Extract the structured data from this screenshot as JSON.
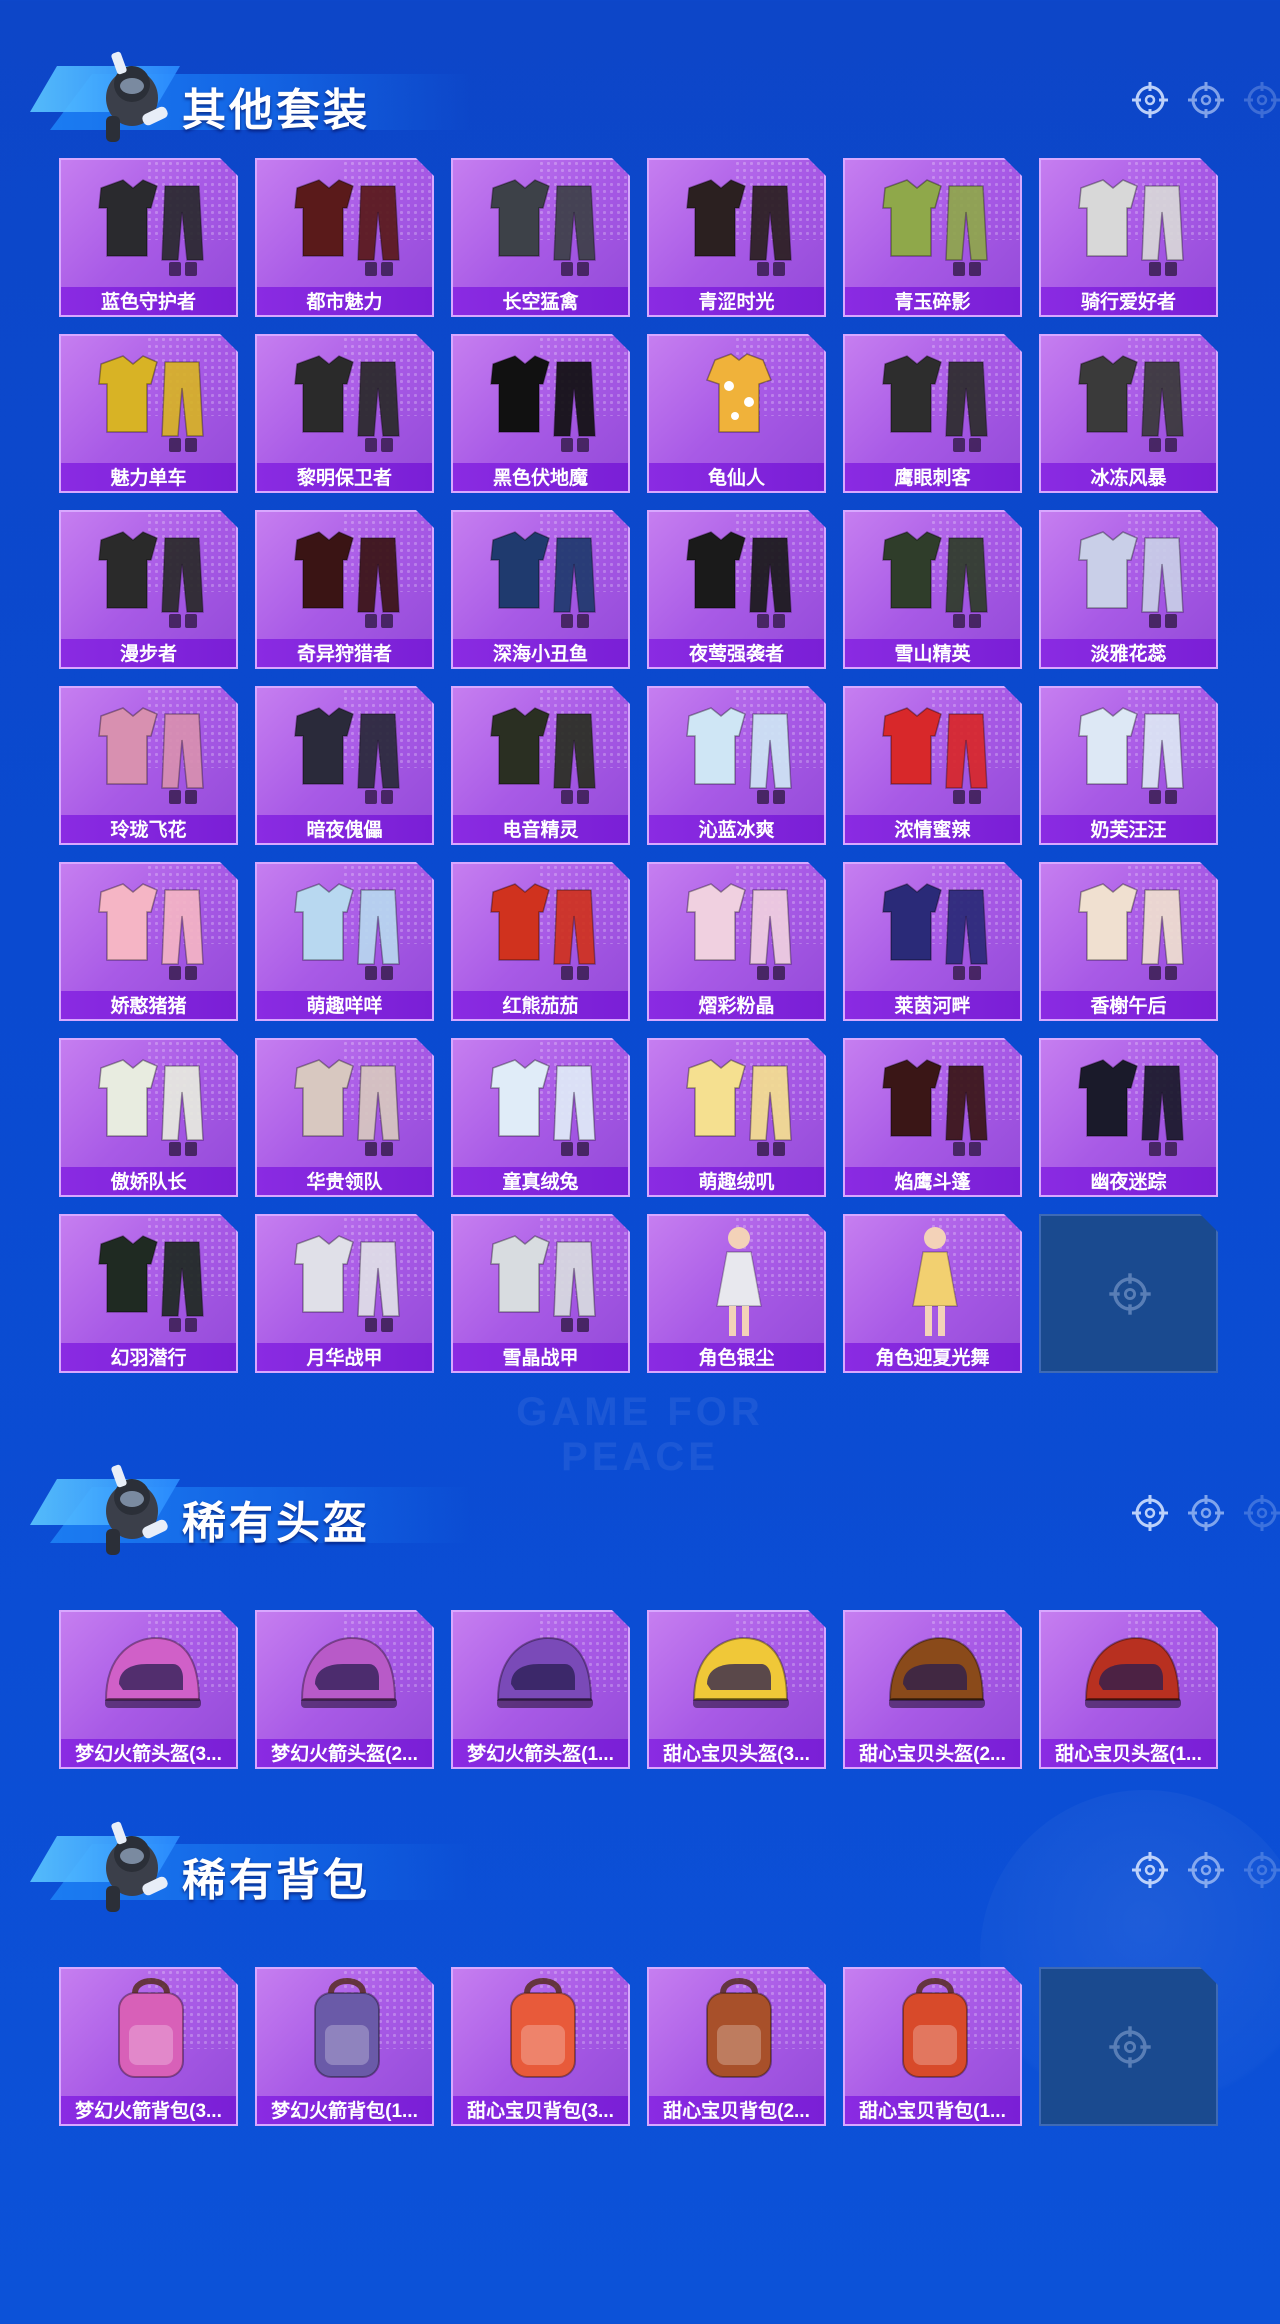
{
  "sections": [
    {
      "title": "其他套装",
      "items": [
        {
          "label": "蓝色守护者",
          "kind": "outfit",
          "color": "#2a2a2e"
        },
        {
          "label": "都市魅力",
          "kind": "outfit",
          "color": "#5a1a1a"
        },
        {
          "label": "长空猛禽",
          "kind": "outfit",
          "color": "#3d4148"
        },
        {
          "label": "青涩时光",
          "kind": "outfit",
          "color": "#2b2020"
        },
        {
          "label": "青玉碎影",
          "kind": "outfit",
          "color": "#8fa84a"
        },
        {
          "label": "骑行爱好者",
          "kind": "outfit",
          "color": "#d8d8d8"
        },
        {
          "label": "魅力单车",
          "kind": "outfit",
          "color": "#d8b325"
        },
        {
          "label": "黎明保卫者",
          "kind": "outfit",
          "color": "#2a2a2a"
        },
        {
          "label": "黑色伏地魔",
          "kind": "outfit",
          "color": "#111111"
        },
        {
          "label": "龟仙人",
          "kind": "shirt",
          "color": "#f0b23a"
        },
        {
          "label": "鹰眼刺客",
          "kind": "outfit",
          "color": "#2d2d2d"
        },
        {
          "label": "冰冻风暴",
          "kind": "outfit",
          "color": "#3a3a3a"
        },
        {
          "label": "漫步者",
          "kind": "outfit",
          "color": "#2a2a2a"
        },
        {
          "label": "奇异狩猎者",
          "kind": "outfit",
          "color": "#3a1414"
        },
        {
          "label": "深海小丑鱼",
          "kind": "outfit",
          "color": "#1f3a6e"
        },
        {
          "label": "夜莺强袭者",
          "kind": "outfit",
          "color": "#1a1a1a"
        },
        {
          "label": "雪山精英",
          "kind": "outfit",
          "color": "#2f3d2a"
        },
        {
          "label": "淡雅花蕊",
          "kind": "outfit",
          "color": "#c9cfe8"
        },
        {
          "label": "玲珑飞花",
          "kind": "outfit",
          "color": "#d890b0"
        },
        {
          "label": "暗夜傀儡",
          "kind": "outfit",
          "color": "#2a2a3a"
        },
        {
          "label": "电音精灵",
          "kind": "outfit",
          "color": "#2a2f22"
        },
        {
          "label": "沁蓝冰爽",
          "kind": "outfit",
          "color": "#cfe6f5"
        },
        {
          "label": "浓情蜜辣",
          "kind": "outfit",
          "color": "#d8282a"
        },
        {
          "label": "奶芙汪汪",
          "kind": "outfit",
          "color": "#dde8f5"
        },
        {
          "label": "娇憨猪猪",
          "kind": "outfit",
          "color": "#f5b5c5"
        },
        {
          "label": "萌趣咩咩",
          "kind": "outfit",
          "color": "#b8d8f0"
        },
        {
          "label": "红熊茄茄",
          "kind": "outfit",
          "color": "#d0321e"
        },
        {
          "label": "熠彩粉晶",
          "kind": "outfit",
          "color": "#f0d0e0"
        },
        {
          "label": "莱茵河畔",
          "kind": "outfit",
          "color": "#2a2a78"
        },
        {
          "label": "香榭午后",
          "kind": "outfit",
          "color": "#f0e0d0"
        },
        {
          "label": "傲娇队长",
          "kind": "outfit",
          "color": "#e8ece0"
        },
        {
          "label": "华贵领队",
          "kind": "outfit",
          "color": "#d8c8c0"
        },
        {
          "label": "童真绒兔",
          "kind": "outfit",
          "color": "#e0ecf8"
        },
        {
          "label": "萌趣绒叽",
          "kind": "outfit",
          "color": "#f5e090"
        },
        {
          "label": "焰鹰斗篷",
          "kind": "outfit",
          "color": "#3a1616"
        },
        {
          "label": "幽夜迷踪",
          "kind": "outfit",
          "color": "#1a1a2a"
        },
        {
          "label": "幻羽潜行",
          "kind": "outfit",
          "color": "#1f2a22"
        },
        {
          "label": "月华战甲",
          "kind": "outfit",
          "color": "#e0e0e8"
        },
        {
          "label": "雪晶战甲",
          "kind": "outfit",
          "color": "#d8dce0"
        },
        {
          "label": "角色银尘",
          "kind": "figure",
          "color": "#e8e8ee"
        },
        {
          "label": "角色迎夏光舞",
          "kind": "figure",
          "color": "#f2d070"
        },
        {
          "label": "",
          "kind": "empty",
          "color": ""
        }
      ]
    },
    {
      "title": "稀有头盔",
      "items": [
        {
          "label": "梦幻火箭头盔(3...",
          "kind": "helmet",
          "color": "#d060c8"
        },
        {
          "label": "梦幻火箭头盔(2...",
          "kind": "helmet",
          "color": "#b85ac8"
        },
        {
          "label": "梦幻火箭头盔(1...",
          "kind": "helmet",
          "color": "#7a4ab8"
        },
        {
          "label": "甜心宝贝头盔(3...",
          "kind": "helmet",
          "color": "#f0c838"
        },
        {
          "label": "甜心宝贝头盔(2...",
          "kind": "helmet",
          "color": "#8a4a1a"
        },
        {
          "label": "甜心宝贝头盔(1...",
          "kind": "helmet",
          "color": "#b83020"
        }
      ]
    },
    {
      "title": "稀有背包",
      "items": [
        {
          "label": "梦幻火箭背包(3...",
          "kind": "backpack",
          "color": "#d860b8"
        },
        {
          "label": "梦幻火箭背包(1...",
          "kind": "backpack",
          "color": "#6a5aa8"
        },
        {
          "label": "甜心宝贝背包(3...",
          "kind": "backpack",
          "color": "#e85a3a"
        },
        {
          "label": "甜心宝贝背包(2...",
          "kind": "backpack",
          "color": "#a8502a"
        },
        {
          "label": "甜心宝贝背包(1...",
          "kind": "backpack",
          "color": "#d84a2a"
        },
        {
          "label": "",
          "kind": "empty",
          "color": ""
        }
      ]
    }
  ],
  "watermark": "GAME FOR PEACE"
}
